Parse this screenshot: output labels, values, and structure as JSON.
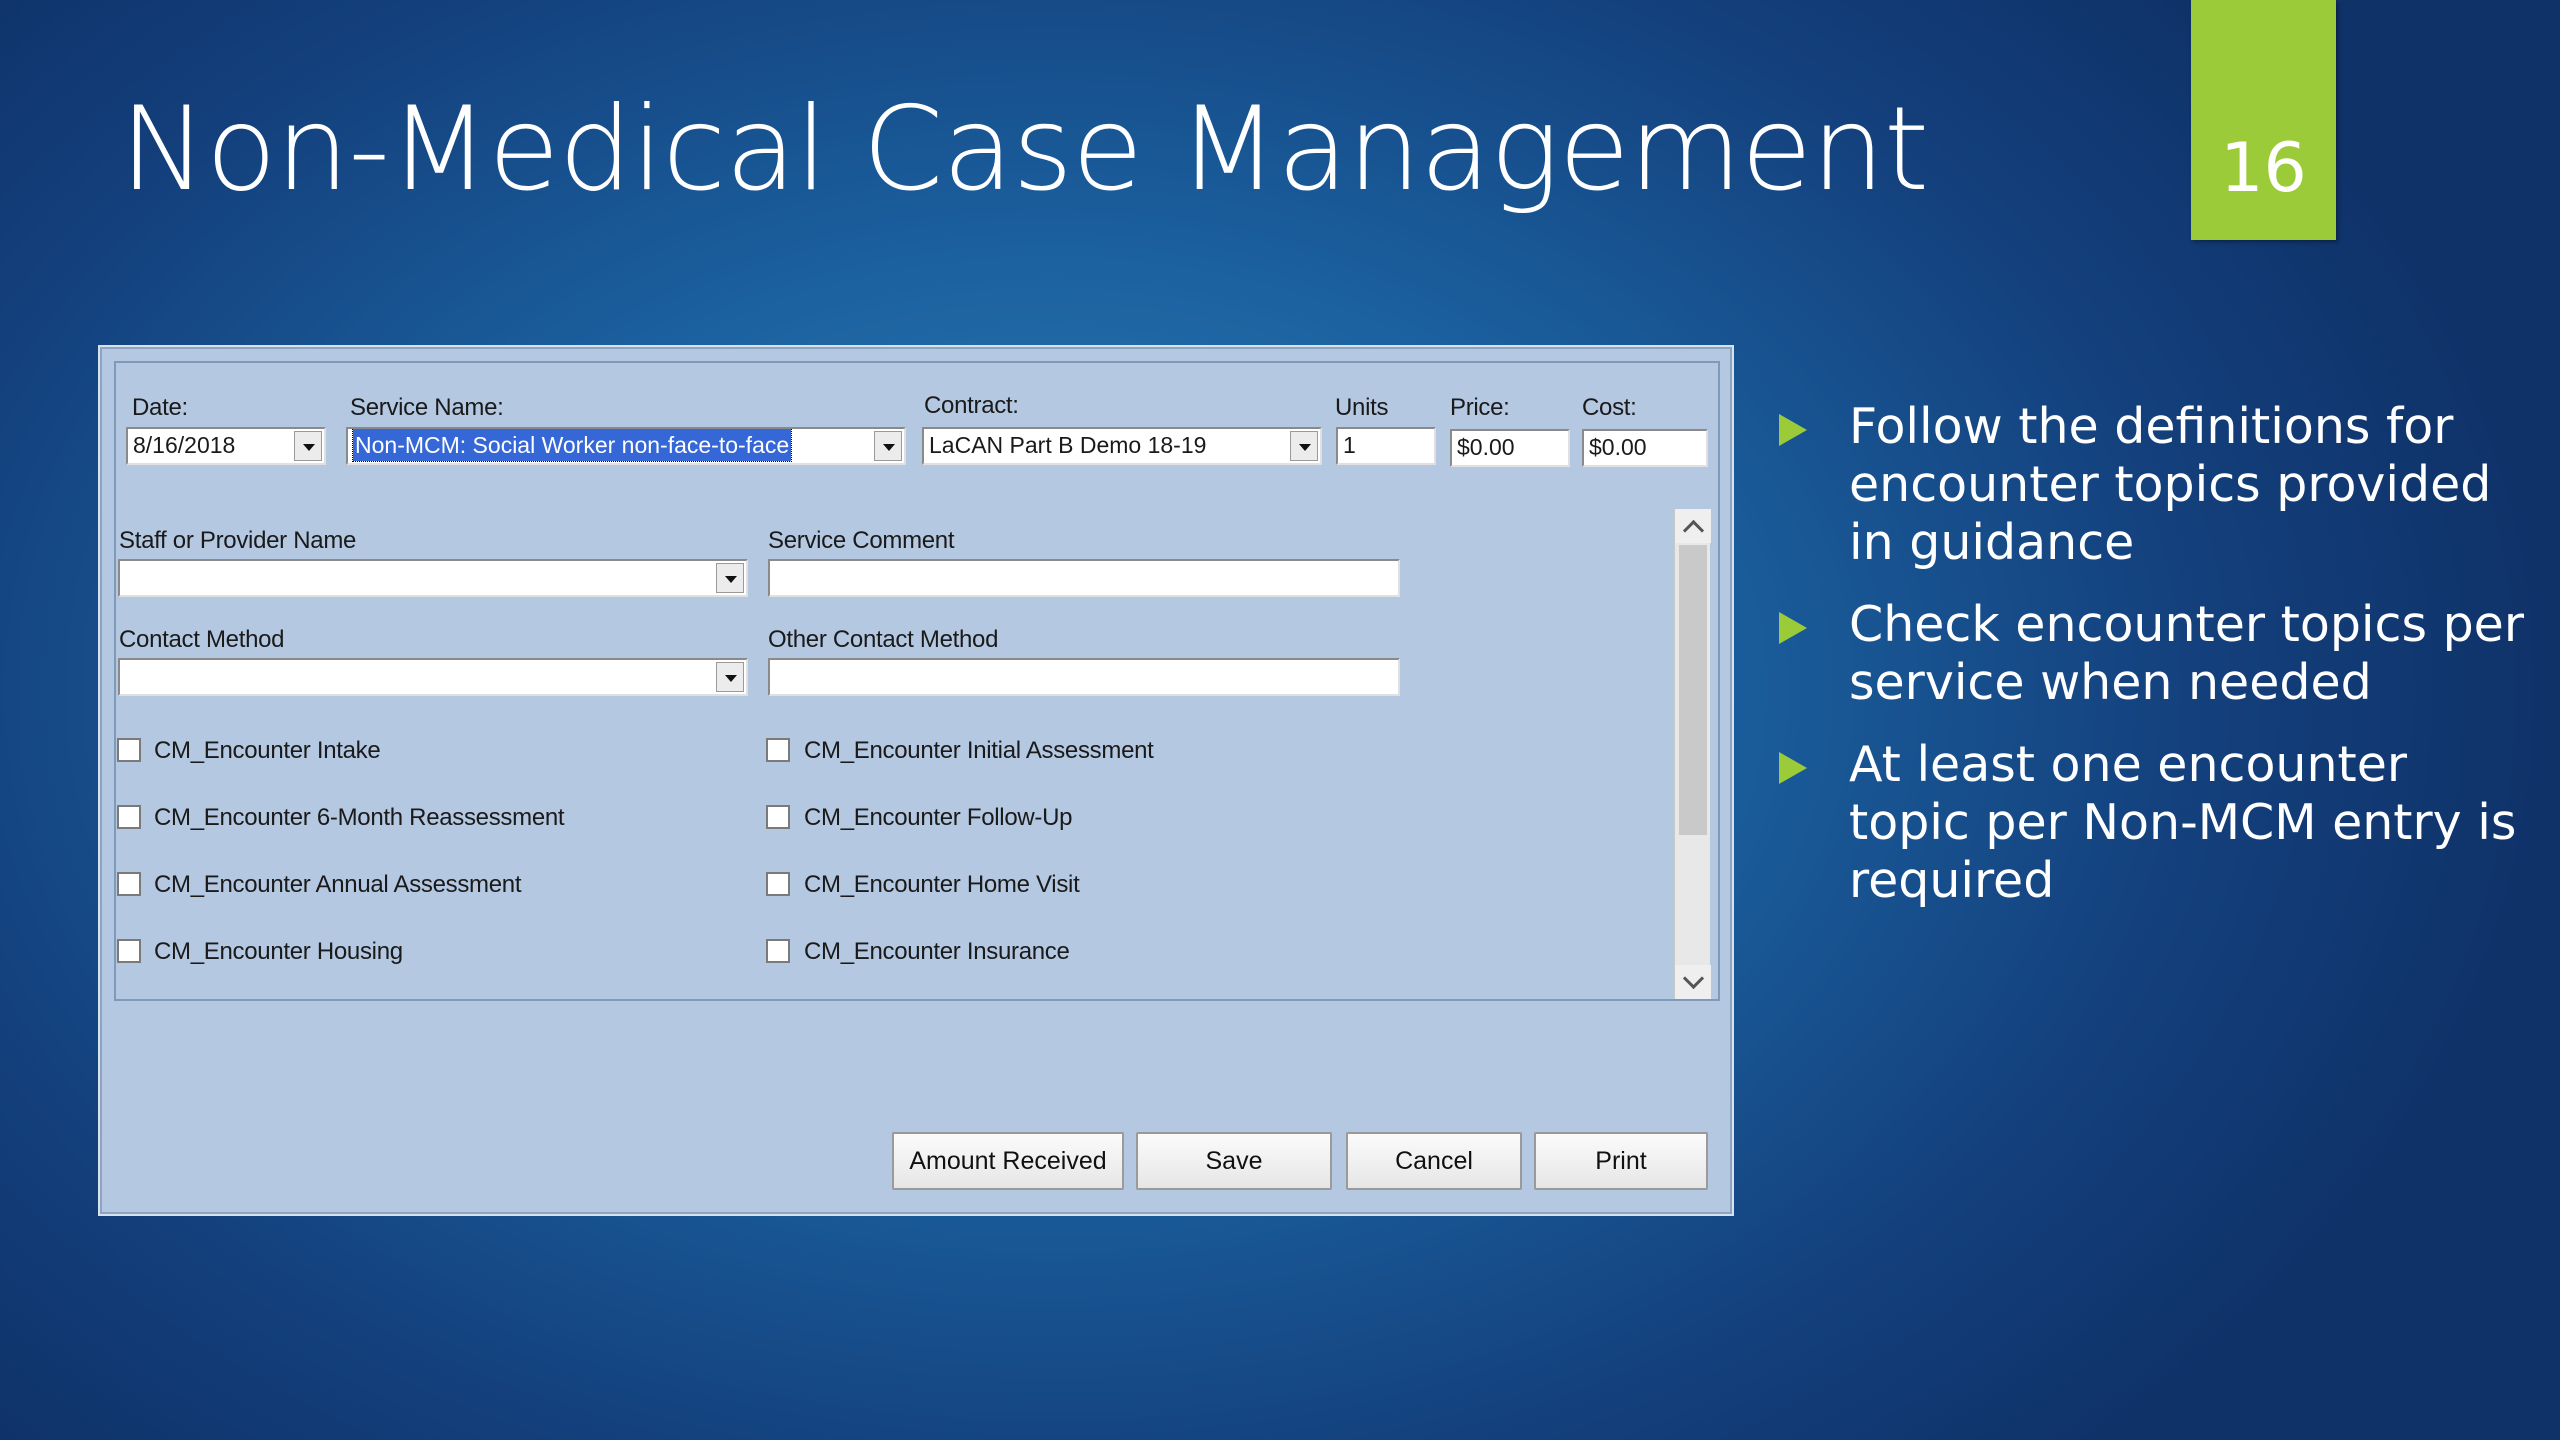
{
  "slide": {
    "title": "Non-Medical Case Management",
    "page_number": "16",
    "bullets": [
      "Follow the definitions for encounter topics provided in guidance",
      "Check encounter topics per service when needed",
      "At least one encounter topic per Non-MCM entry is required"
    ]
  },
  "dialog": {
    "date": {
      "label": "Date:",
      "value": "8/16/2018"
    },
    "service_name": {
      "label": "Service Name:",
      "value": "Non-MCM: Social Worker non-face-to-face"
    },
    "contract": {
      "label": "Contract:",
      "value": "LaCAN Part B Demo 18-19"
    },
    "units": {
      "label": "Units",
      "value": "1"
    },
    "price": {
      "label": "Price:",
      "value": "$0.00"
    },
    "cost": {
      "label": "Cost:",
      "value": "$0.00"
    },
    "staff": {
      "label": "Staff or Provider Name",
      "value": ""
    },
    "service_comment": {
      "label": "Service Comment",
      "value": ""
    },
    "contact_method": {
      "label": "Contact Method",
      "value": ""
    },
    "other_contact_method": {
      "label": "Other Contact Method",
      "value": ""
    },
    "checkboxes": [
      "CM_Encounter Intake",
      "CM_Encounter Initial Assessment",
      "CM_Encounter 6-Month Reassessment",
      "CM_Encounter Follow-Up",
      "CM_Encounter Annual Assessment",
      "CM_Encounter Home Visit",
      "CM_Encounter Housing",
      "CM_Encounter Insurance"
    ],
    "buttons": {
      "amount_received": "Amount Received",
      "save": "Save",
      "cancel": "Cancel",
      "print": "Print"
    }
  },
  "colors": {
    "accent": "#9bcb39",
    "dialog_bg": "#b4c8e2",
    "selection": "#3568d6"
  }
}
